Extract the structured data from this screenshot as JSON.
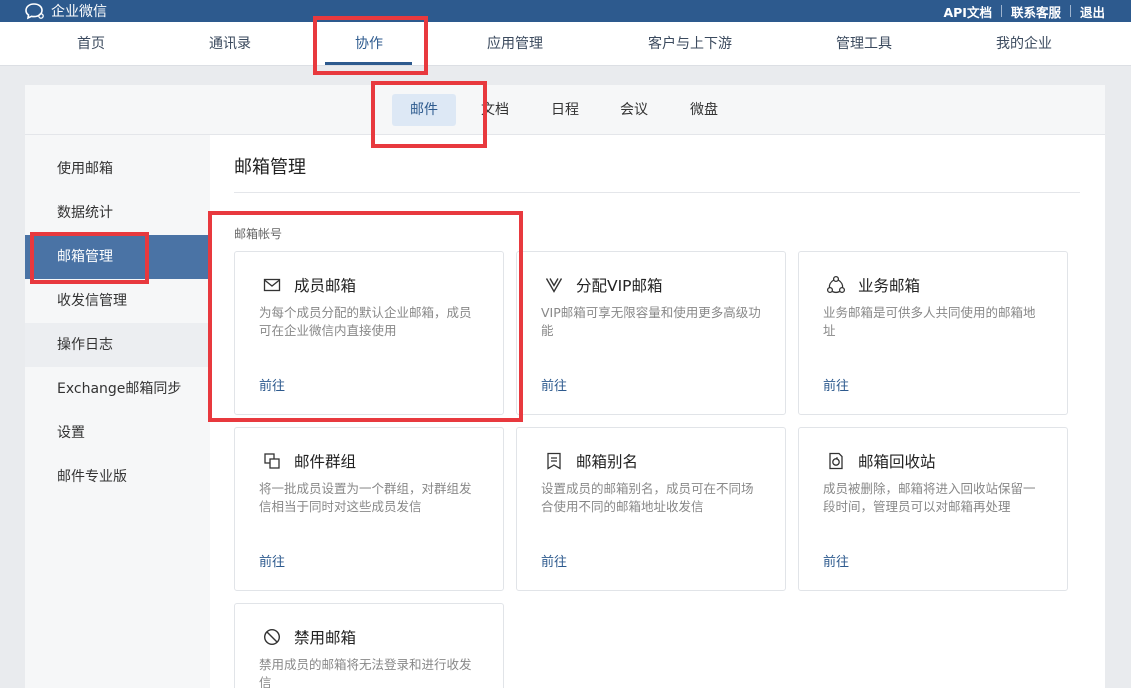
{
  "topbar": {
    "app_name": "企业微信",
    "links": [
      "API文档",
      "联系客服",
      "退出"
    ]
  },
  "main_nav": {
    "items": [
      "首页",
      "通讯录",
      "协作",
      "应用管理",
      "客户与上下游",
      "管理工具",
      "我的企业"
    ],
    "active": "协作"
  },
  "sub_tabs": {
    "items": [
      "邮件",
      "文档",
      "日程",
      "会议",
      "微盘"
    ],
    "active": "邮件"
  },
  "sidebar": {
    "items": [
      "使用邮箱",
      "数据统计",
      "邮箱管理",
      "收发信管理",
      "操作日志",
      "Exchange邮箱同步",
      "设置",
      "邮件专业版"
    ],
    "active": "邮箱管理"
  },
  "content": {
    "title": "邮箱管理",
    "section_label": "邮箱帐号",
    "cards": [
      {
        "title": "成员邮箱",
        "desc": "为每个成员分配的默认企业邮箱，成员可在企业微信内直接使用",
        "link": "前往",
        "icon": "envelope-icon"
      },
      {
        "title": "分配VIP邮箱",
        "desc": "VIP邮箱可享无限容量和使用更多高级功能",
        "link": "前往",
        "icon": "vip-icon"
      },
      {
        "title": "业务邮箱",
        "desc": "业务邮箱是可供多人共同使用的邮箱地址",
        "link": "前往",
        "icon": "share-icon"
      },
      {
        "title": "邮件群组",
        "desc": "将一批成员设置为一个群组，对群组发信相当于同时对这些成员发信",
        "link": "前往",
        "icon": "group-icon"
      },
      {
        "title": "邮箱别名",
        "desc": "设置成员的邮箱别名，成员可在不同场合使用不同的邮箱地址收发信",
        "link": "前往",
        "icon": "alias-icon"
      },
      {
        "title": "邮箱回收站",
        "desc": "成员被删除，邮箱将进入回收站保留一段时间，管理员可以对邮箱再处理",
        "link": "前往",
        "icon": "recycle-icon"
      },
      {
        "title": "禁用邮箱",
        "desc": "禁用成员的邮箱将无法登录和进行收发信",
        "link": "",
        "icon": "ban-icon"
      }
    ]
  },
  "colors": {
    "brand": "#2d5a8e",
    "sidebar_active": "#4a73a5",
    "highlight": "#e8393e"
  }
}
